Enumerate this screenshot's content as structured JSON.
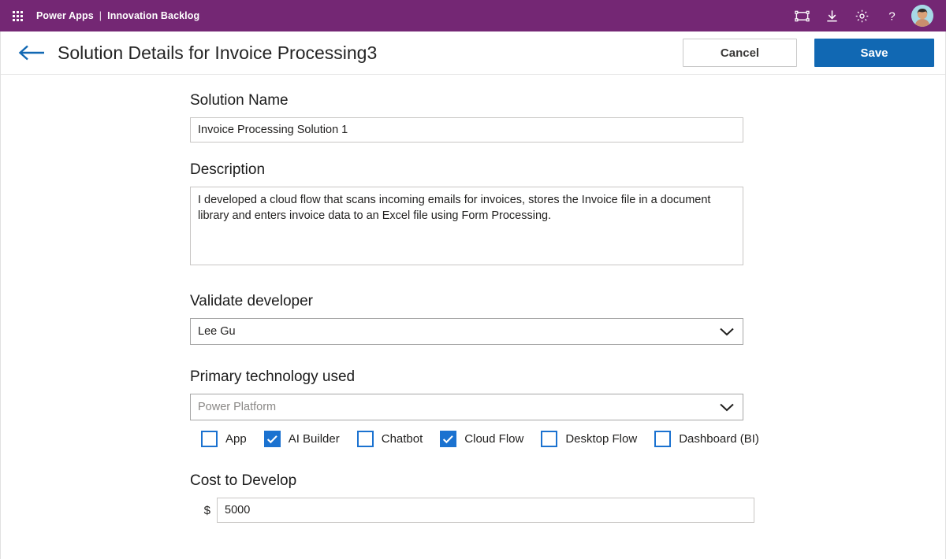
{
  "suite": {
    "waffle_name": "app-launcher-icon",
    "brand": "Power Apps",
    "separator": "|",
    "app_name": "Innovation Backlog",
    "icons": [
      {
        "name": "presentation-mode-icon",
        "glyph": "frame"
      },
      {
        "name": "download-icon",
        "glyph": "download"
      },
      {
        "name": "settings-gear-icon",
        "glyph": "gear"
      },
      {
        "name": "help-question-icon",
        "glyph": "question"
      }
    ],
    "avatar_name": "user-avatar",
    "bar_color": "#742774"
  },
  "command_bar": {
    "back_label": "back-arrow",
    "title": "Solution Details for Invoice Processing3",
    "cancel_label": "Cancel",
    "save_label": "Save",
    "accent_color": "#1168b3"
  },
  "form": {
    "solution_name": {
      "label": "Solution Name",
      "value": "Invoice Processing Solution 1",
      "placeholder": "Solution Name"
    },
    "description": {
      "label": "Description",
      "value": "I developed a cloud flow that scans incoming emails for invoices, stores the Invoice file in a document library and enters invoice data to an Excel file using Form Processing.",
      "placeholder": "Description"
    },
    "validate_developer": {
      "label": "Validate developer",
      "value": "Lee Gu",
      "is_placeholder": false
    },
    "primary_technology": {
      "label": "Primary technology used",
      "value": "Power Platform",
      "is_placeholder": true
    },
    "technology_options": [
      {
        "label": "App",
        "checked": false
      },
      {
        "label": "AI Builder",
        "checked": true
      },
      {
        "label": "Chatbot",
        "checked": false
      },
      {
        "label": "Cloud Flow",
        "checked": true
      },
      {
        "label": "Desktop Flow",
        "checked": false
      },
      {
        "label": "Dashboard (BI)",
        "checked": false
      }
    ],
    "cost": {
      "label": "Cost to Develop",
      "currency": "$",
      "value": "5000"
    },
    "checkbox_color": "#1b72d0"
  }
}
